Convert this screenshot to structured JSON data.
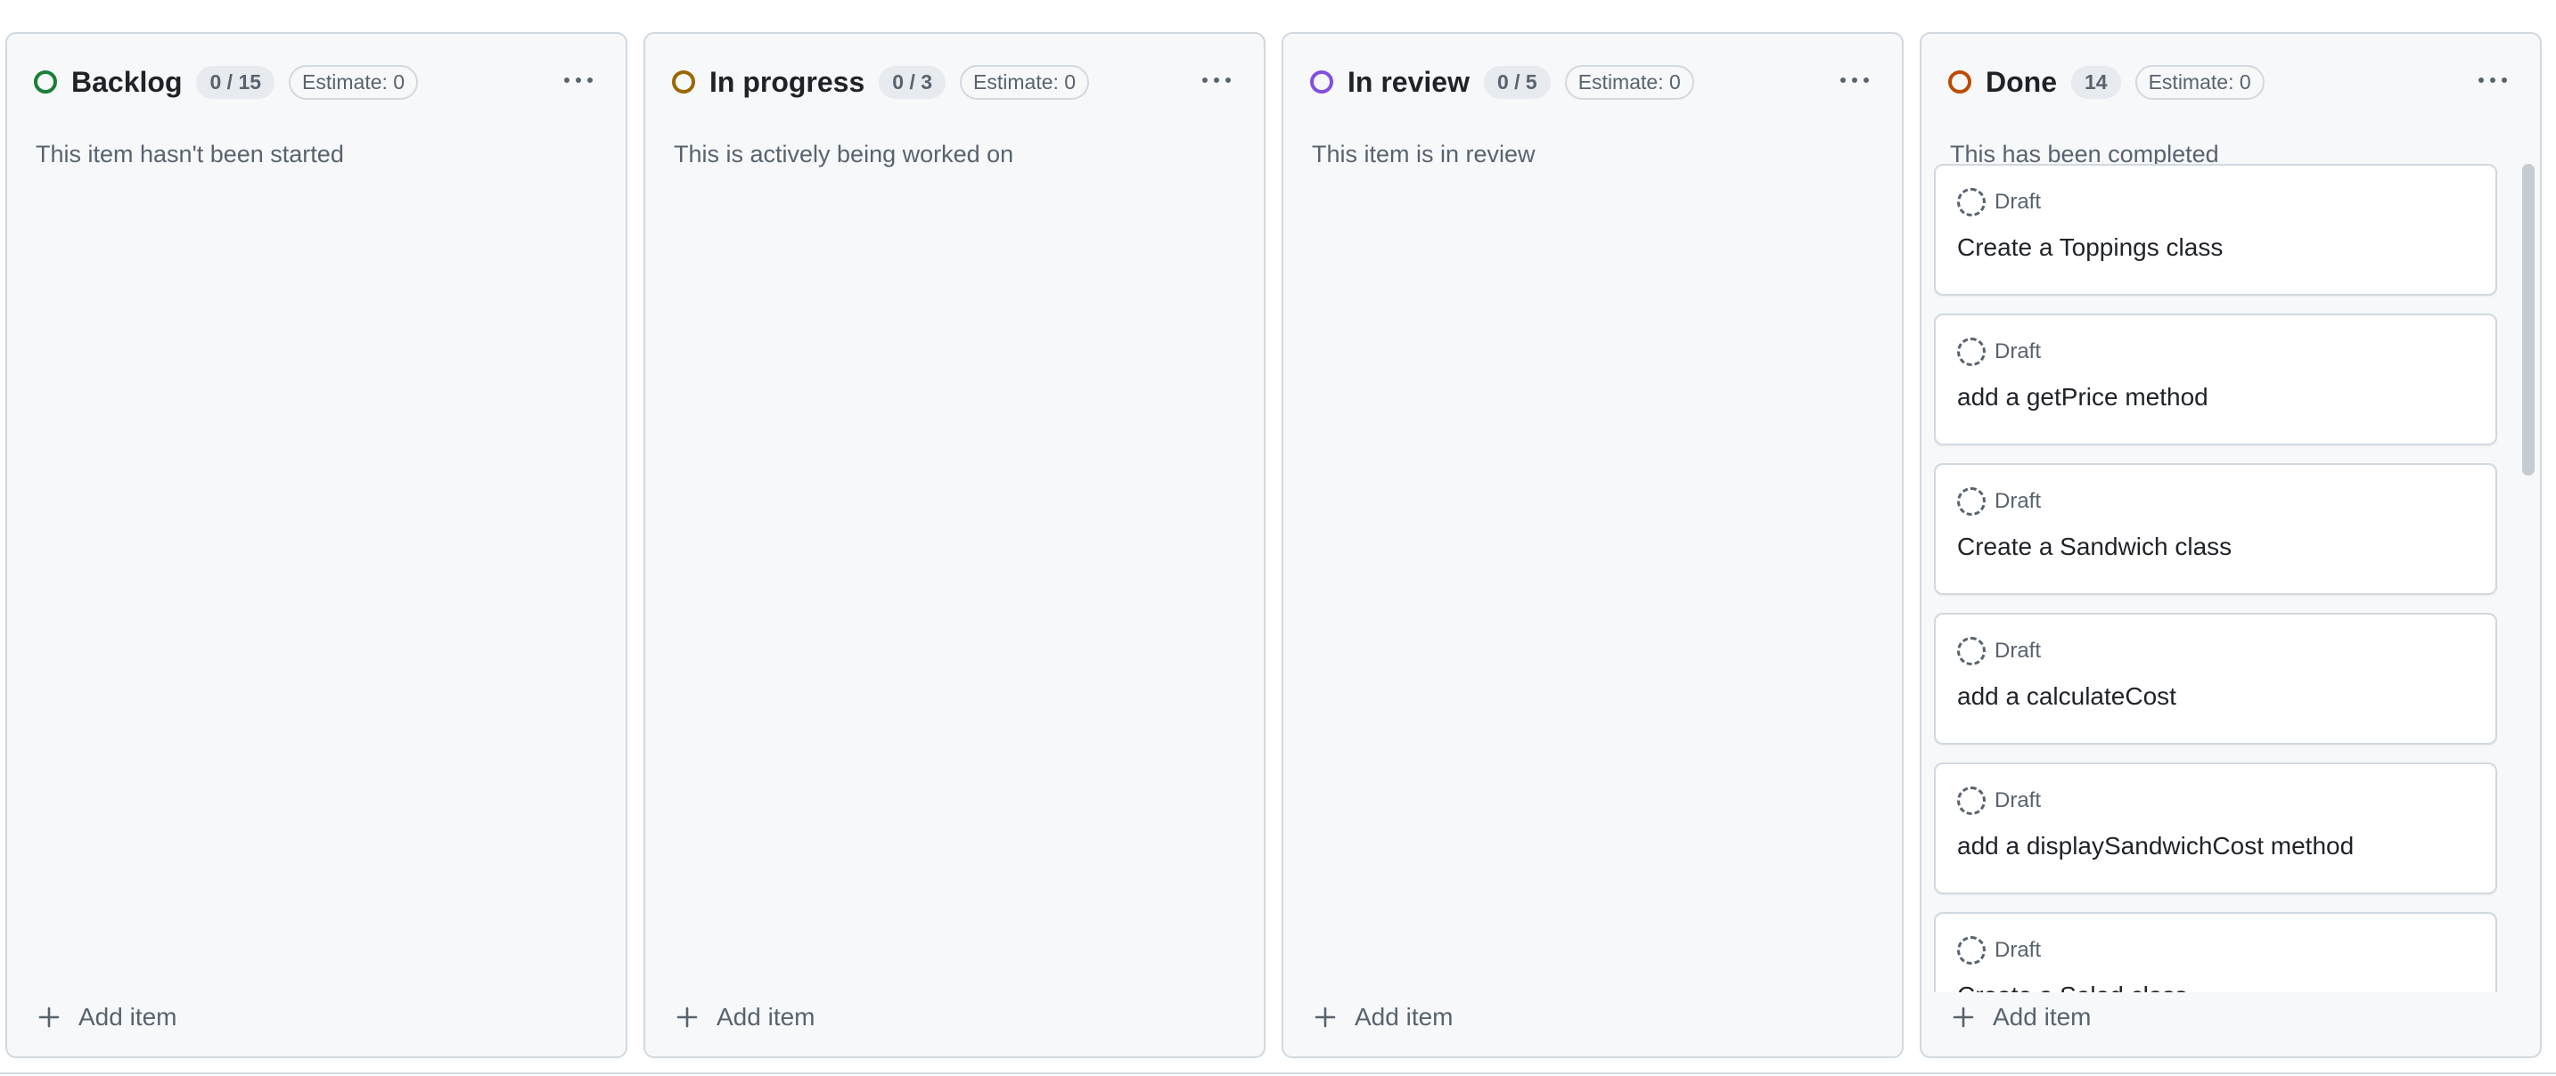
{
  "columns": [
    {
      "title": "Backlog",
      "count": "0 / 15",
      "estimate": "Estimate: 0",
      "description": "This item hasn't been started",
      "status_color": "#1a7f37",
      "add_label": "Add item",
      "more_icon": "kebab-horizontal-icon",
      "cards": []
    },
    {
      "title": "In progress",
      "count": "0 / 3",
      "estimate": "Estimate: 0",
      "description": "This is actively being worked on",
      "status_color": "#9a6700",
      "add_label": "Add item",
      "more_icon": "kebab-horizontal-icon",
      "cards": []
    },
    {
      "title": "In review",
      "count": "0 / 5",
      "estimate": "Estimate: 0",
      "description": "This item is in review",
      "status_color": "#8250df",
      "add_label": "Add item",
      "more_icon": "kebab-horizontal-icon",
      "cards": []
    },
    {
      "title": "Done",
      "count": "14",
      "estimate": "Estimate: 0",
      "description": "This has been completed",
      "status_color": "#bc4c00",
      "add_label": "Add item",
      "more_icon": "kebab-horizontal-icon",
      "cards": [
        {
          "type": "Draft",
          "title": "Create a Toppings class"
        },
        {
          "type": "Draft",
          "title": "add a getPrice method"
        },
        {
          "type": "Draft",
          "title": "Create a Sandwich class"
        },
        {
          "type": "Draft",
          "title": "add a calculateCost"
        },
        {
          "type": "Draft",
          "title": "add a displaySandwichCost method"
        },
        {
          "type": "Draft",
          "title": "Create a Salad class"
        }
      ]
    }
  ]
}
